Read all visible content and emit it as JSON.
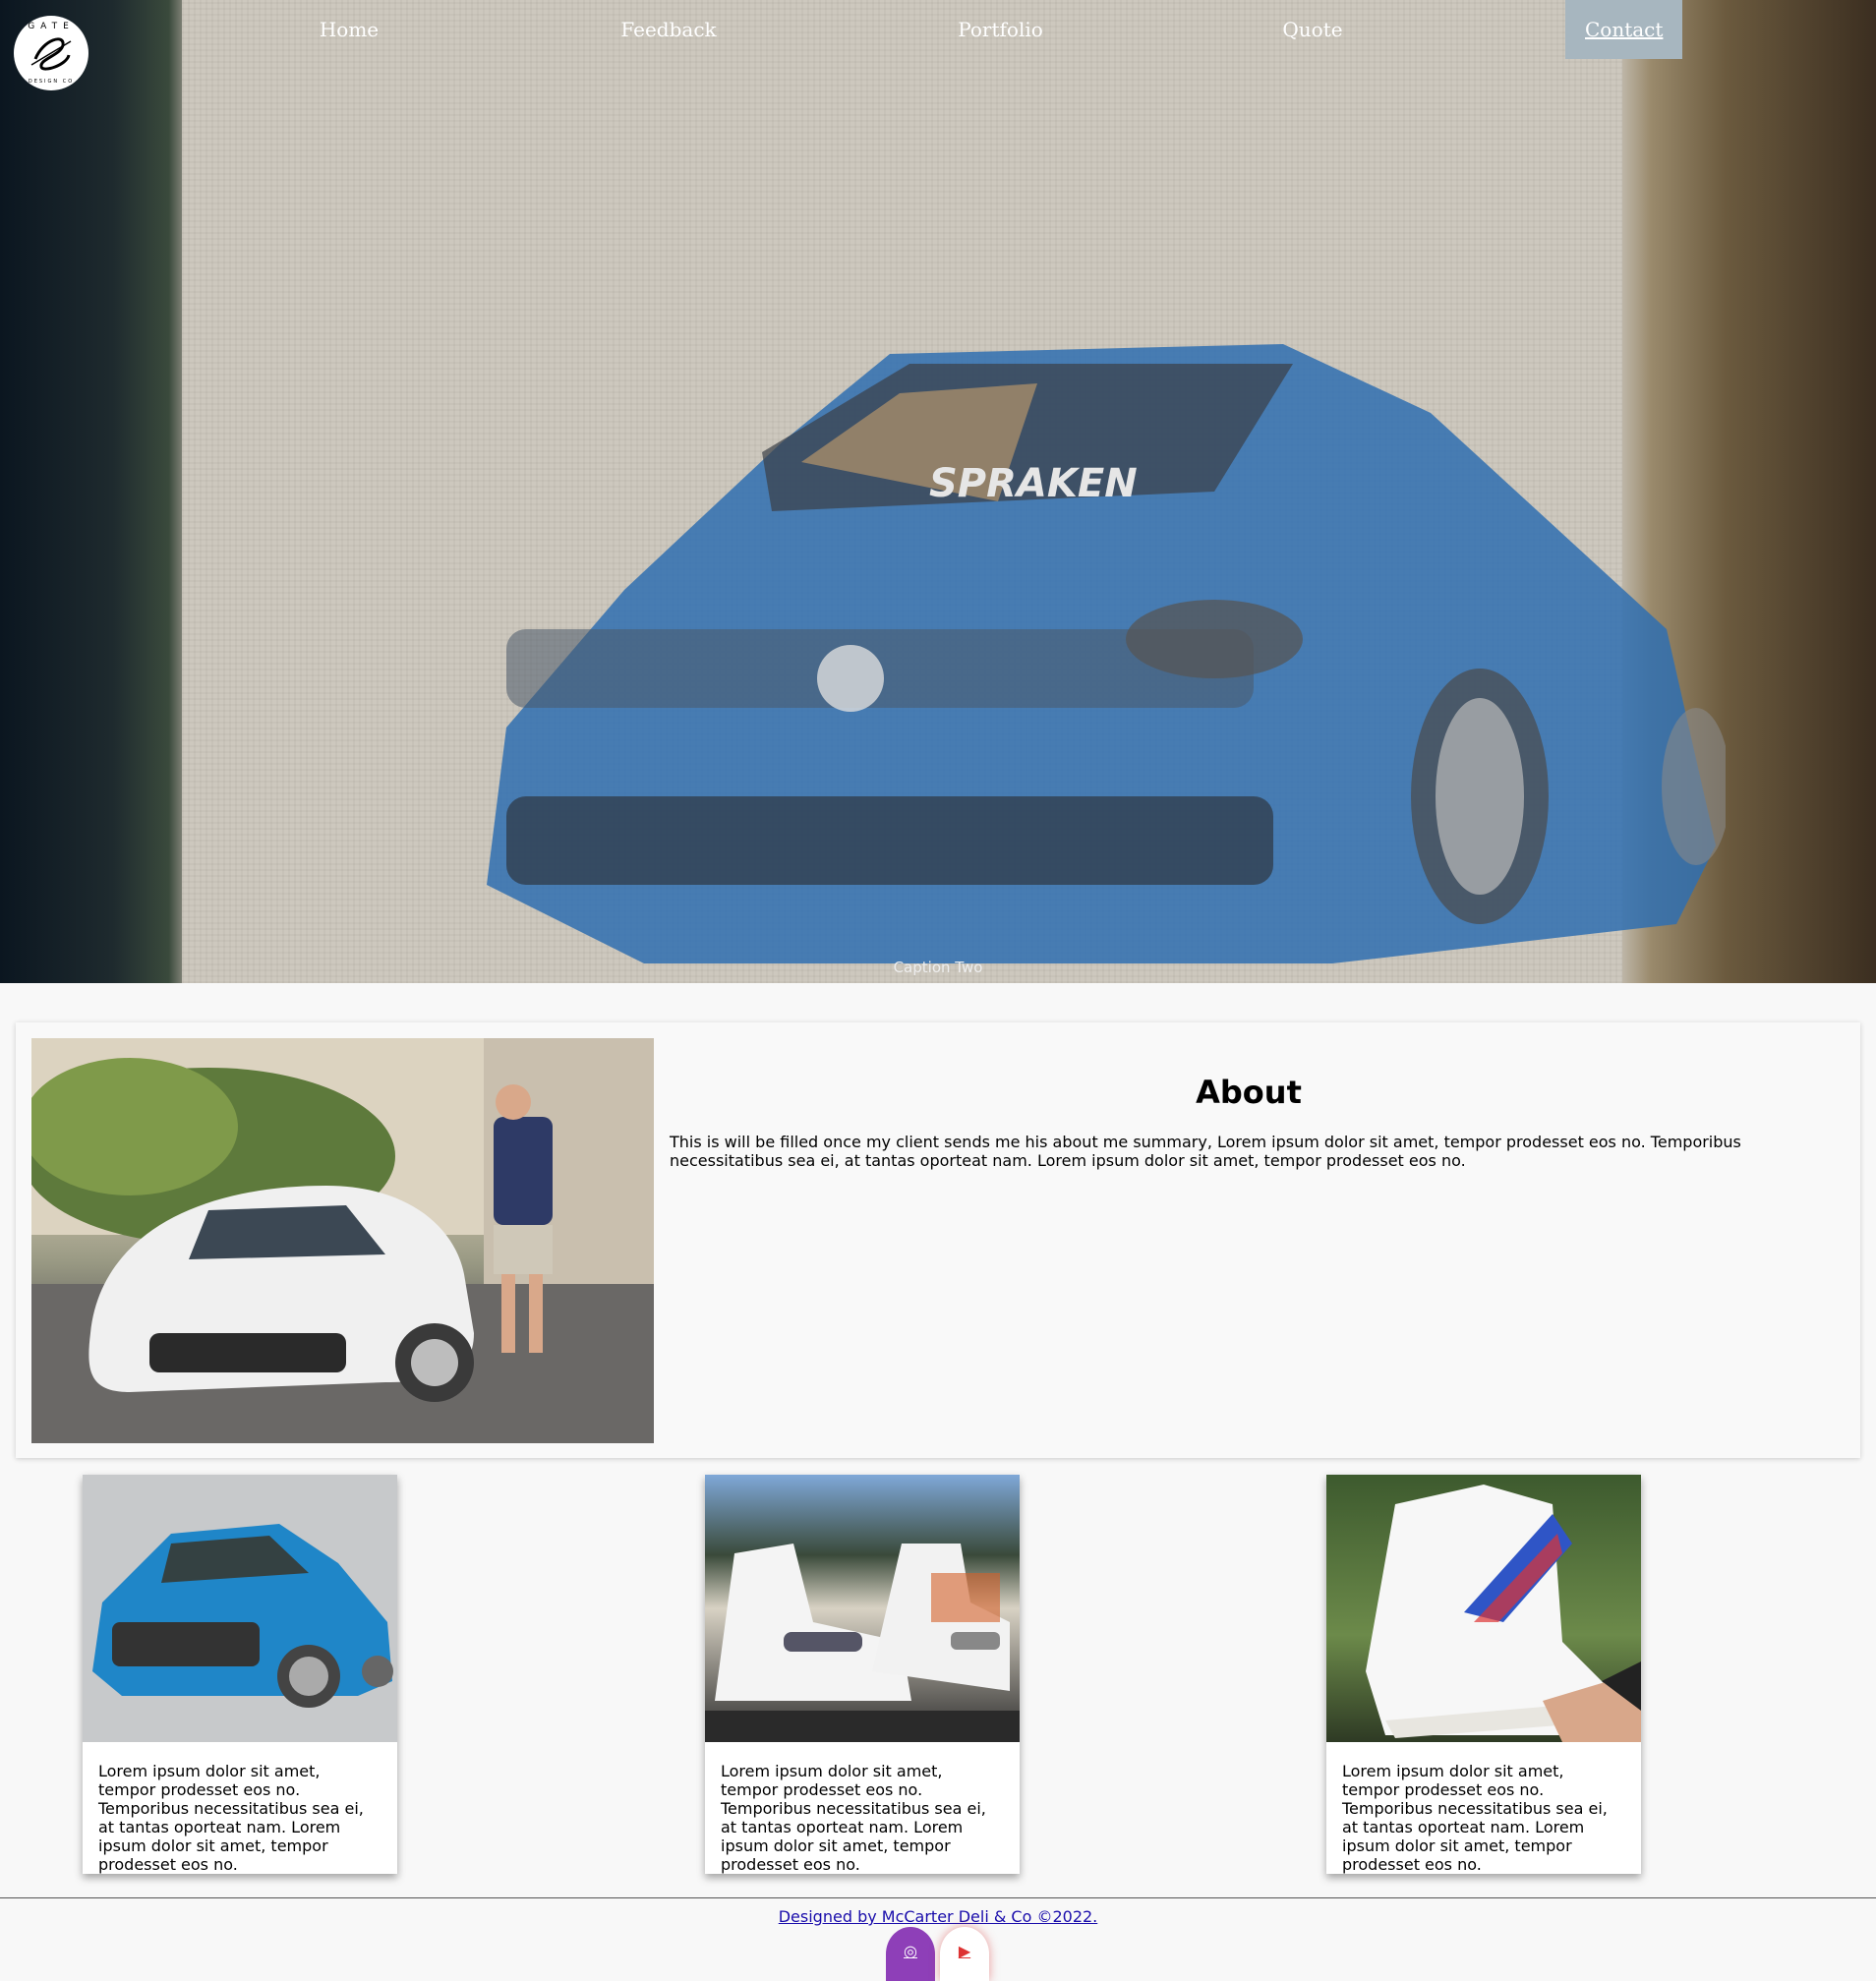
{
  "brand": {
    "logo_top": "GATE",
    "logo_bottom": "DESIGN CO"
  },
  "nav": {
    "items": [
      {
        "label": "Home"
      },
      {
        "label": "Feedback"
      },
      {
        "label": "Portfolio"
      },
      {
        "label": "Quote"
      },
      {
        "label": "Contact"
      }
    ],
    "active": "Contact"
  },
  "carousel": {
    "caption": "Caption Two",
    "slide_count": 3
  },
  "about": {
    "title": "About",
    "text": "This is will be filled once my client sends me his about me summary, Lorem ipsum dolor sit amet, tempor prodesset eos no. Temporibus necessitatibus sea ei, at tantas oporteat nam. Lorem ipsum dolor sit amet, tempor prodesset eos no."
  },
  "cards": [
    {
      "text": "Lorem ipsum dolor sit amet, tempor prodesset eos no. Temporibus necessitatibus sea ei, at tantas oporteat nam. Lorem ipsum dolor sit amet, tempor prodesset eos no."
    },
    {
      "text": "Lorem ipsum dolor sit amet, tempor prodesset eos no. Temporibus necessitatibus sea ei, at tantas oporteat nam. Lorem ipsum dolor sit amet, tempor prodesset eos no."
    },
    {
      "text": "Lorem ipsum dolor sit amet, tempor prodesset eos no. Temporibus necessitatibus sea ei, at tantas oporteat nam. Lorem ipsum dolor sit amet, tempor prodesset eos no."
    }
  ],
  "footer": {
    "credit": "Designed by McCarter Deli & Co ©2022.",
    "social": [
      {
        "icon": "instagram-icon",
        "glyph": "◎",
        "color": "#8e3fb8"
      },
      {
        "icon": "youtube-icon",
        "glyph": "▶",
        "color": "#dd3333"
      }
    ]
  },
  "colors": {
    "nav_active_bg": "#a7b6bf",
    "page_bg": "#f8f8f8",
    "link": "#1a0dab"
  }
}
